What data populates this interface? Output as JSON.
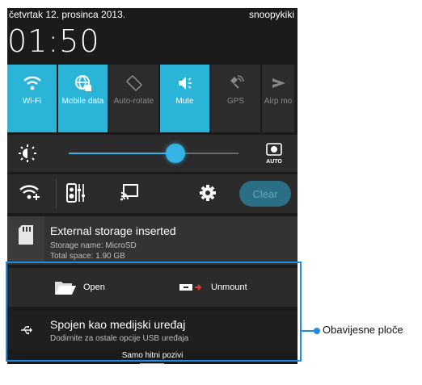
{
  "status_bar": {
    "date": "četvrtak 12. prosinca 2013.",
    "carrier": "snoopykiki"
  },
  "clock": "01:50",
  "quick_settings": [
    {
      "label": "Wi-Fi",
      "state": "on",
      "icon": "wifi-icon"
    },
    {
      "label": "Mobile data",
      "state": "on",
      "icon": "mobile-data-icon"
    },
    {
      "label": "Auto-rotate",
      "state": "off",
      "icon": "auto-rotate-icon"
    },
    {
      "label": "Mute",
      "state": "on",
      "icon": "mute-icon"
    },
    {
      "label": "GPS",
      "state": "off",
      "icon": "gps-icon"
    },
    {
      "label": "Airp mo",
      "state": "off",
      "icon": "airplane-mode-icon"
    }
  ],
  "brightness": {
    "level": 0.63,
    "auto_icon": "auto-brightness-icon",
    "auto_label": "AUTO"
  },
  "actions": {
    "clear_label": "Clear"
  },
  "storage_notification": {
    "title": "External storage inserted",
    "line1": "Storage name: MicroSD",
    "line2": "Total space: 1.90 GB",
    "open_label": "Open",
    "unmount_label": "Unmount"
  },
  "usb_notification": {
    "title": "Spojen kao medijski uređaj",
    "subtitle": "Dodirnite za ostale opcije USB uređaja"
  },
  "emergency_label": "Samo hitni pozivi",
  "callout_label": "Obavijesne ploče",
  "colors": {
    "accent": "#2ab4d8",
    "callout": "#1e8ce0",
    "panel": "#1b1b1b"
  }
}
